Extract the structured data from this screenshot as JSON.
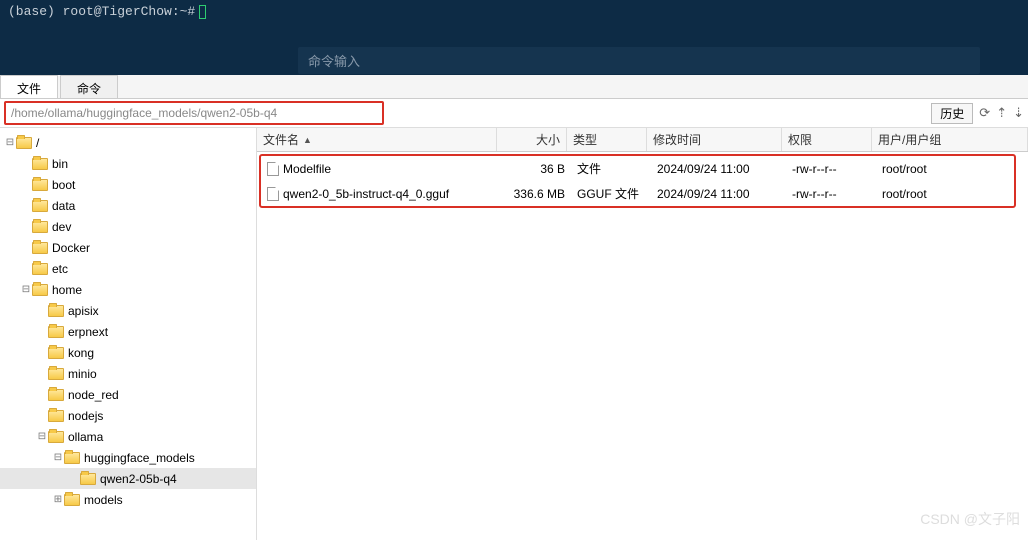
{
  "terminal": {
    "prompt": "(base) root@TigerChow:~#",
    "cmd_placeholder": "命令输入"
  },
  "tabs": {
    "file": "文件",
    "cmd": "命令"
  },
  "path": "/home/ollama/huggingface_models/qwen2-05b-q4",
  "history_btn": "历史",
  "columns": {
    "name": "文件名",
    "size": "大小",
    "type": "类型",
    "mod": "修改时间",
    "perm": "权限",
    "owner": "用户/用户组"
  },
  "tree": {
    "root": "/",
    "items": [
      {
        "l": 1,
        "name": "bin",
        "e": ""
      },
      {
        "l": 1,
        "name": "boot",
        "e": ""
      },
      {
        "l": 1,
        "name": "data",
        "e": ""
      },
      {
        "l": 1,
        "name": "dev",
        "e": ""
      },
      {
        "l": 1,
        "name": "Docker",
        "e": ""
      },
      {
        "l": 1,
        "name": "etc",
        "e": ""
      },
      {
        "l": 1,
        "name": "home",
        "e": "-"
      },
      {
        "l": 2,
        "name": "apisix",
        "e": ""
      },
      {
        "l": 2,
        "name": "erpnext",
        "e": ""
      },
      {
        "l": 2,
        "name": "kong",
        "e": ""
      },
      {
        "l": 2,
        "name": "minio",
        "e": ""
      },
      {
        "l": 2,
        "name": "node_red",
        "e": ""
      },
      {
        "l": 2,
        "name": "nodejs",
        "e": ""
      },
      {
        "l": 2,
        "name": "ollama",
        "e": "-"
      },
      {
        "l": 3,
        "name": "huggingface_models",
        "e": "-"
      },
      {
        "l": 4,
        "name": "qwen2-05b-q4",
        "e": "",
        "sel": true
      },
      {
        "l": 3,
        "name": "models",
        "e": "+"
      }
    ]
  },
  "files": [
    {
      "name": "Modelfile",
      "size": "36 B",
      "type": "文件",
      "mod": "2024/09/24 11:00",
      "perm": "-rw-r--r--",
      "owner": "root/root"
    },
    {
      "name": "qwen2-0_5b-instruct-q4_0.gguf",
      "size": "336.6 MB",
      "type": "GGUF 文件",
      "mod": "2024/09/24 11:00",
      "perm": "-rw-r--r--",
      "owner": "root/root"
    }
  ],
  "watermark": "CSDN @文子阳"
}
